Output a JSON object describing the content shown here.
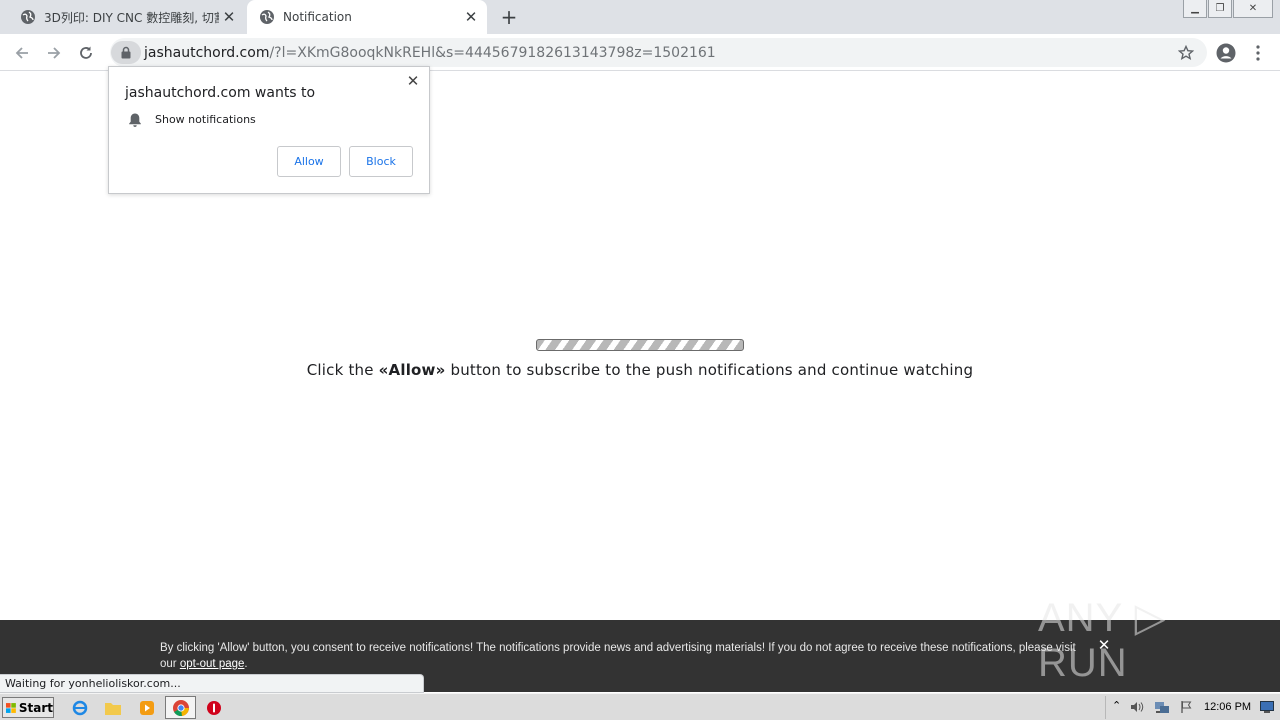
{
  "tabs": [
    {
      "title": "3D列印: DIY CNC 數控雕刻, 切割, 鑽",
      "active": false
    },
    {
      "title": "Notification",
      "active": true
    }
  ],
  "address": {
    "host": "jashautchord.com",
    "path": "/?l=XKmG8ooqkNkREHl&s=4445679182613143798z=1502161"
  },
  "permission": {
    "title": "jashautchord.com wants to",
    "item": "Show notifications",
    "allow_label": "Allow",
    "block_label": "Block"
  },
  "page": {
    "cta_before": "Click the ",
    "cta_bold": "«Allow»",
    "cta_after": " button to subscribe to the push notifications and continue watching"
  },
  "consent": {
    "text": "By clicking 'Allow' button, you consent to receive notifications! The notifications provide news and advertising materials! If you do not agree to receive these notifications, please visit our ",
    "link": "opt-out page",
    "end": "."
  },
  "watermark": "ANY ▷ RUN",
  "status_text": "Waiting for yonhelioliskor.com...",
  "taskbar": {
    "start_label": "Start",
    "clock": "12:06 PM"
  },
  "colors": {
    "accent": "#1a73e8",
    "consent_bg": "#333333",
    "tabstrip": "#dee1e6"
  }
}
